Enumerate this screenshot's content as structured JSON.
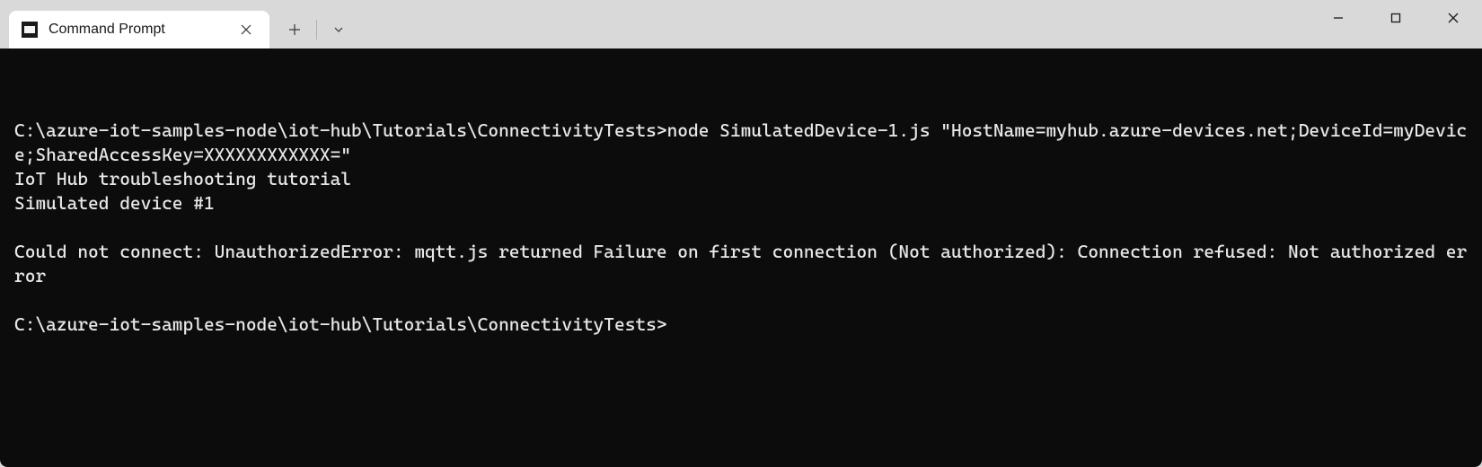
{
  "tab": {
    "title": "Command Prompt"
  },
  "terminal": {
    "lines": [
      "C:\\azure-iot-samples-node\\iot-hub\\Tutorials\\ConnectivityTests>node SimulatedDevice-1.js \"HostName=myhub.azure-devices.net;DeviceId=myDevice;SharedAccessKey=XXXXXXXXXXXX=\"",
      "IoT Hub troubleshooting tutorial",
      "Simulated device #1",
      "",
      "Could not connect: UnauthorizedError: mqtt.js returned Failure on first connection (Not authorized): Connection refused: Not authorized error",
      "",
      "C:\\azure-iot-samples-node\\iot-hub\\Tutorials\\ConnectivityTests>"
    ]
  }
}
